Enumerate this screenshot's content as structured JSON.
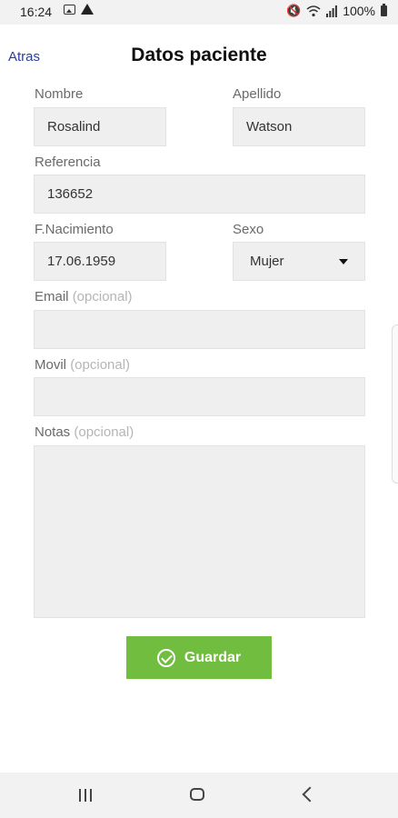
{
  "status_bar": {
    "time": "16:24",
    "battery": "100%",
    "icons_left": [
      "image-icon",
      "warning-icon"
    ],
    "icons_right": [
      "mute-icon",
      "wifi-icon",
      "signal-icon",
      "battery-icon"
    ]
  },
  "header": {
    "back_label": "Atras",
    "title": "Datos paciente"
  },
  "form": {
    "nombre": {
      "label": "Nombre",
      "value": "Rosalind"
    },
    "apellido": {
      "label": "Apellido",
      "value": "Watson"
    },
    "referencia": {
      "label": "Referencia",
      "value": "136652"
    },
    "nacimiento": {
      "label": "F.Nacimiento",
      "value": "17.06.1959"
    },
    "sexo": {
      "label": "Sexo",
      "value": "Mujer"
    },
    "email": {
      "label": "Email",
      "optional": "(opcional)",
      "value": ""
    },
    "movil": {
      "label": "Movil",
      "optional": "(opcional)",
      "value": ""
    },
    "notas": {
      "label": "Notas",
      "optional": "(opcional)",
      "value": ""
    }
  },
  "actions": {
    "save_label": "Guardar"
  },
  "colors": {
    "accent_green": "#70bd3f",
    "link_blue": "#2a3f9c",
    "field_bg": "#efefef"
  }
}
